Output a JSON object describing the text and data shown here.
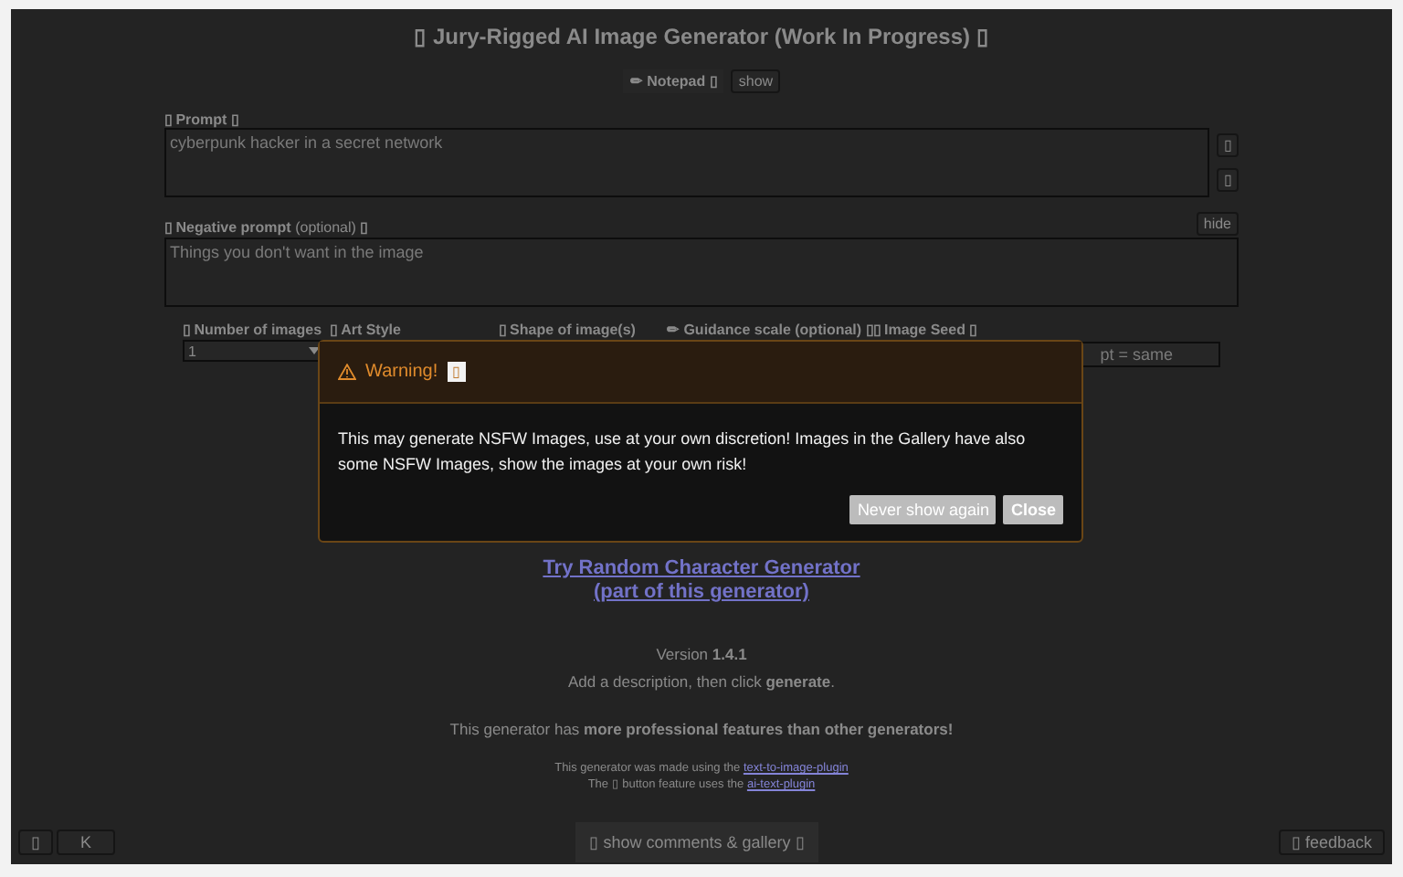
{
  "title": "▯ Jury-Rigged AI Image Generator (Work In Progress) ▯",
  "notepad": {
    "label": "✏ Notepad ▯",
    "button": "show"
  },
  "prompt": {
    "label": "▯ Prompt ▯",
    "placeholder": "cyberpunk hacker in a secret network",
    "side_buttons": [
      "▯",
      "▯"
    ]
  },
  "negative_prompt": {
    "label": "▯ Negative prompt",
    "note": "(optional)",
    "label_end": "▯",
    "placeholder": "Things you don't want in the image",
    "button": "hide"
  },
  "settings": {
    "labels": [
      "▯ Number of images",
      "▯ Art Style",
      "▯ Shape of image(s)",
      "✏ Guidance scale (optional) ▯",
      "▯ Image Seed ▯"
    ],
    "number_of_images": "1",
    "seed_value": "pt = same"
  },
  "modal": {
    "title": "Warning!",
    "title_badge": "▯",
    "message": "This may generate NSFW Images, use at your own discretion! Images in the Gallery have also some NSFW Images, show the images at your own risk!",
    "buttons": [
      "Never show again",
      "Close"
    ]
  },
  "random_link": [
    "Try Random Character Generator",
    "(part of this generator)"
  ],
  "version": "Version **1.4.1**",
  "instruction": "Add a description, then click **generate**.",
  "features": "This generator has **more professional features than other generators!**",
  "credits": [
    {
      "text": "This generator was made using the",
      "link": "text-to-image-plugin"
    },
    {
      "text": "The ▯ button feature uses the",
      "link": "ai-text-plugin"
    }
  ],
  "footer": {
    "left_buttons": [
      "▯",
      "K"
    ],
    "center_button": "▯ show comments & gallery ▯",
    "right_button": "▯ feedback"
  }
}
